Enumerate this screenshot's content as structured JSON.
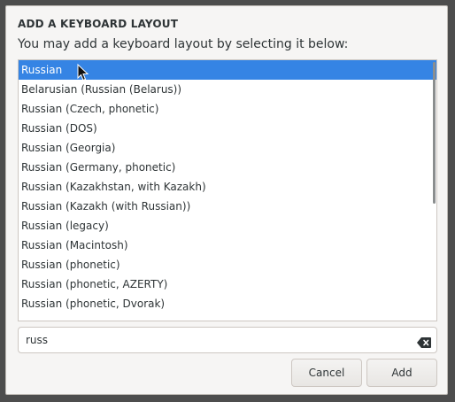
{
  "dialog": {
    "title": "ADD A KEYBOARD LAYOUT",
    "prompt": "You may add a keyboard layout by selecting it below:"
  },
  "layouts": {
    "selected_index": 0,
    "items": [
      "Russian",
      "Belarusian (Russian (Belarus))",
      "Russian (Czech, phonetic)",
      "Russian (DOS)",
      "Russian (Georgia)",
      "Russian (Germany, phonetic)",
      "Russian (Kazakhstan, with Kazakh)",
      "Russian (Kazakh (with Russian))",
      "Russian (legacy)",
      "Russian (Macintosh)",
      "Russian (phonetic)",
      "Russian (phonetic, AZERTY)",
      "Russian (phonetic, Dvorak)"
    ]
  },
  "search": {
    "value": "russ"
  },
  "buttons": {
    "cancel_label": "Cancel",
    "add_label": "Add"
  },
  "icons": {
    "clear": "backspace-clear-icon",
    "cursor": "mouse-pointer-icon"
  },
  "colors": {
    "selection": "#3584e4",
    "text": "#2e3436",
    "dialog_bg": "#f6f5f4"
  }
}
